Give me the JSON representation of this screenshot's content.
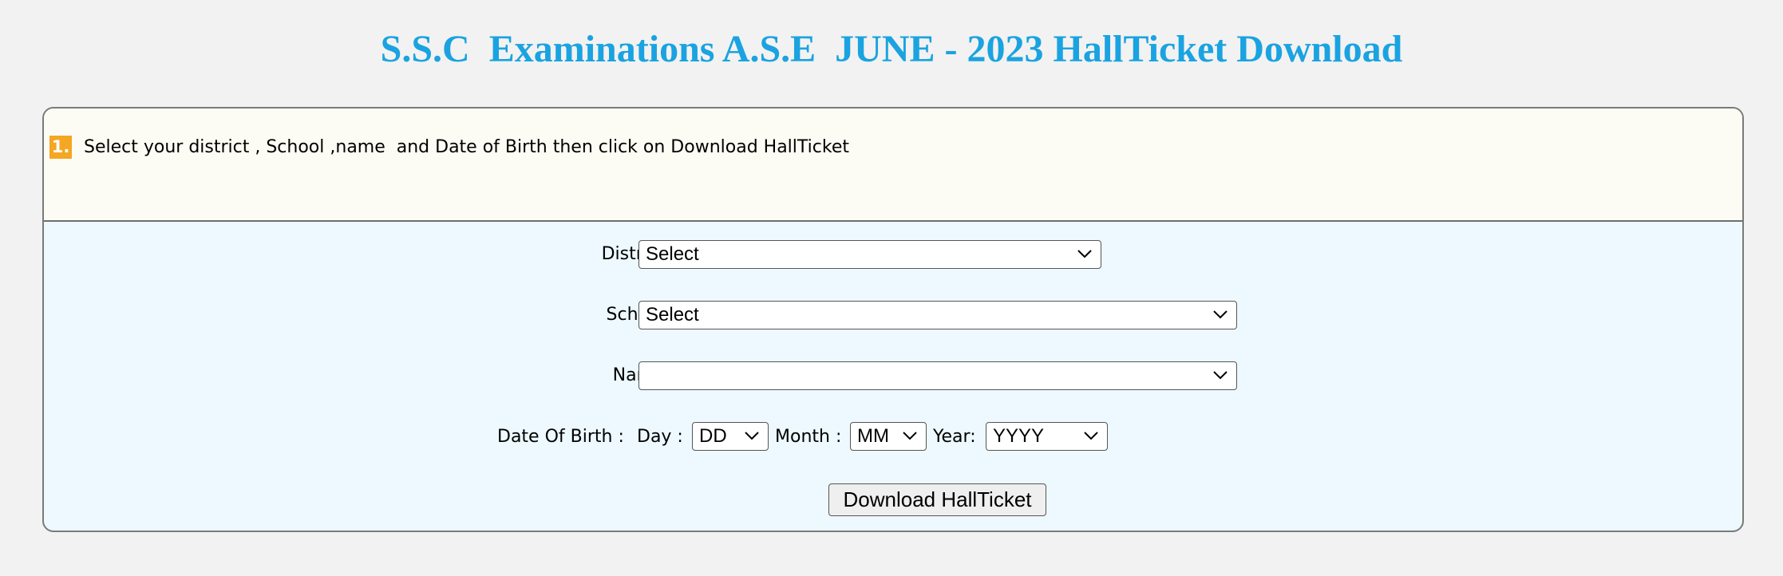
{
  "header": {
    "title": "S.S.C  Examinations A.S.E  JUNE - 2023 HallTicket Download"
  },
  "instructions": {
    "step_number": "1.",
    "text": "Select your district , School ,name  and Date of Birth then click on Download HallTicket"
  },
  "form": {
    "district": {
      "label": "District:",
      "selected": "Select"
    },
    "school": {
      "label": "School:",
      "selected": "Select"
    },
    "name": {
      "label": "Name:",
      "selected": ""
    },
    "dob": {
      "label": "Date Of Birth :",
      "day_label": "Day :",
      "day_selected": "DD",
      "month_label": "Month :",
      "month_selected": "MM",
      "year_label": "Year:",
      "year_selected": "YYYY"
    },
    "download_label": "Download HallTicket"
  },
  "colors": {
    "title": "#1aa3e0",
    "badge": "#f5a623",
    "instructions_bg": "#fdfcf4",
    "form_bg": "#edf9fe",
    "page_bg": "#f2f2f2"
  }
}
